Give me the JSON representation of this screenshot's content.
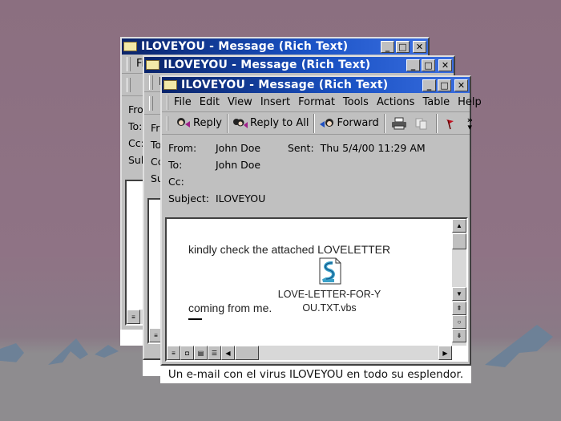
{
  "window": {
    "title": "ILOVEYOU - Message (Rich Text)",
    "controls": {
      "minimize": "_",
      "maximize": "□",
      "close": "✕"
    }
  },
  "menu": [
    "File",
    "Edit",
    "View",
    "Insert",
    "Format",
    "Tools",
    "Actions",
    "Table",
    "Help"
  ],
  "menu_hotkeys": [
    "F",
    "E",
    "V",
    "I",
    "o",
    "T",
    "A",
    "a",
    "H"
  ],
  "toolbar": {
    "reply": "Reply",
    "reply_all": "Reply to All",
    "forward": "Forward",
    "overflow": "»"
  },
  "header": {
    "from_label": "From:",
    "from_value": "John Doe",
    "sent_label": "Sent:",
    "sent_value": "Thu 5/4/00 11:29 AM",
    "to_label": "To:",
    "to_value": "John Doe",
    "cc_label": "Cc:",
    "cc_value": "",
    "subject_label": "Subject:",
    "subject_value": "ILOVEYOU"
  },
  "back_windows": {
    "labels_a": [
      "Fro",
      "To:",
      "Cc:",
      "Sub"
    ],
    "labels_b": [
      "Fr",
      "To",
      "Cc",
      "Su"
    ],
    "menu_fragment_a": "Fi",
    "menu_fragment_b": "F",
    "caption_fragment": "U"
  },
  "message": {
    "line1": "kindly check the attached LOVELETTER",
    "line2": "coming from me.",
    "attachment_name_line1": "LOVE-LETTER-FOR-Y",
    "attachment_name_line2": "OU.TXT.vbs"
  },
  "caption": "Un e-mail con el virus ILOVEYOU en todo su esplendor.",
  "colors": {
    "titlebar_start": "#0a246a",
    "titlebar_end": "#3a6ee0",
    "window_face": "#c0c0c0",
    "background_sky": "#8b6f80",
    "background_ground": "#8e8c8f",
    "mountains": "#6e8196"
  }
}
